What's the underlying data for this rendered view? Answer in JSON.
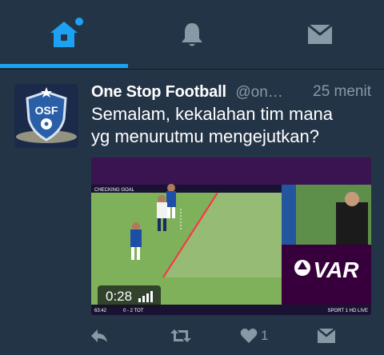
{
  "tabs": [
    {
      "id": "home",
      "icon": "home-icon",
      "active": true,
      "has_badge": true
    },
    {
      "id": "notifications",
      "icon": "bell-icon",
      "active": false
    },
    {
      "id": "messages",
      "icon": "envelope-icon",
      "active": false
    }
  ],
  "tweet": {
    "avatar_text": "OSF",
    "display_name": "One Stop Football",
    "handle": "@on…",
    "time": "25 menit",
    "text_line1": "Semalam, kekalahan tim mana",
    "text_line2": "yg menurutmu mengejutkan?",
    "media": {
      "overlay_label": "CHECKING GOAL",
      "var_text": "VAR",
      "score_text": "0 - 2 TOT",
      "clock_text": "63:42",
      "broadcaster_text": "SPORT 1 HD LIVE",
      "duration": "0:28"
    },
    "actions": {
      "like_count": "1"
    }
  },
  "colors": {
    "background": "#243447",
    "accent": "#1da1f2",
    "muted": "#8899a6",
    "var_purple": "#37003c"
  }
}
